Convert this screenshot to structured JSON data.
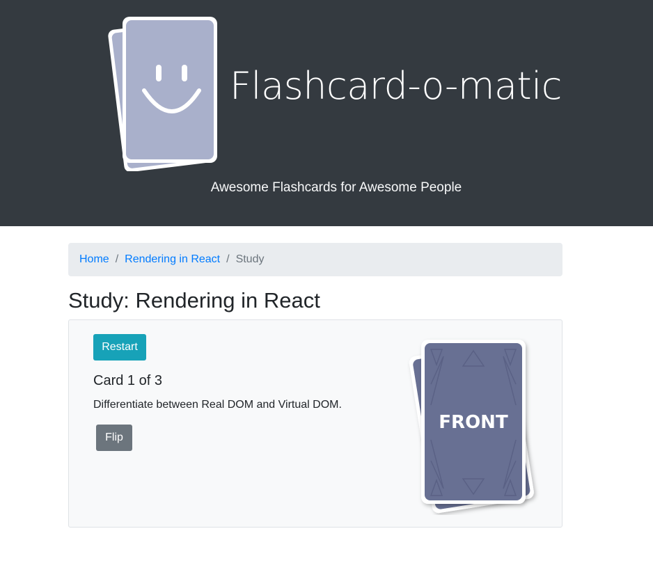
{
  "header": {
    "title": "Flashcard-o-matic",
    "tagline": "Awesome Flashcards for Awesome People",
    "logo_icon": "smiley-flashcards-icon",
    "colors": {
      "background": "#343a40",
      "card_fill": "#a9b0cb",
      "title": "#ffffff"
    }
  },
  "breadcrumb": {
    "items": [
      {
        "label": "Home",
        "link": true
      },
      {
        "label": "Rendering in React",
        "link": true
      },
      {
        "label": "Study",
        "link": false
      }
    ],
    "separator": "/"
  },
  "page": {
    "title": "Study: Rendering in React"
  },
  "study_card": {
    "restart_label": "Restart",
    "count_label": "Card 1 of 3",
    "front_text": "Differentiate between Real DOM and Virtual DOM.",
    "flip_label": "Flip",
    "image_label": "FRONT",
    "image_icon": "card-front-icon",
    "colors": {
      "restart": "#17a2b8",
      "flip": "#6c757d",
      "card_face": "#676f93"
    }
  }
}
